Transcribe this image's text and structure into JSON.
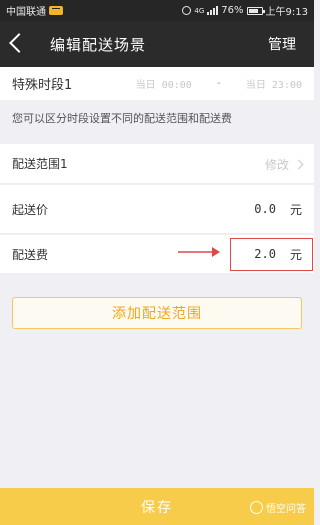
{
  "status_bar": {
    "carrier": "中国联通",
    "battery": "76%",
    "battery_level": 0.76,
    "time": "上午9:13",
    "network": "4G"
  },
  "header": {
    "title": "编辑配送场景",
    "manage_label": "管理"
  },
  "segment": {
    "name": "特殊时段1",
    "start_prefix": "当日",
    "start_time": "00:00",
    "separator": "-",
    "end_prefix": "当日",
    "end_time": "23:00"
  },
  "hint": "您可以区分时段设置不同的配送范围和配送费",
  "delivery_range": {
    "label": "配送范围1",
    "edit_label": "修改"
  },
  "min_order": {
    "label": "起送价",
    "value": "0.0",
    "unit": "元"
  },
  "delivery_fee": {
    "label": "配送费",
    "value": "2.0",
    "unit": "元"
  },
  "add_range_label": "添加配送范围",
  "save_label": "保存",
  "watermark": "悟空问答",
  "colors": {
    "title_bar": "#2b2b2b",
    "accent": "#f2a61d",
    "save_button": "#f7cc4a",
    "highlight": "#e04848"
  }
}
